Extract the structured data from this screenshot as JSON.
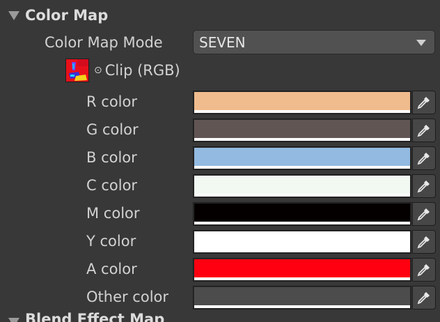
{
  "color_map": {
    "section_title": "Color Map",
    "mode_label": "Color Map Mode",
    "mode_value": "SEVEN",
    "clip_label": "Clip (RGB)",
    "colors": [
      {
        "label": "R color",
        "hex": "#f0bc8e"
      },
      {
        "label": "G color",
        "hex": "#615554"
      },
      {
        "label": "B color",
        "hex": "#93bae0"
      },
      {
        "label": "C color",
        "hex": "#f2f8f2"
      },
      {
        "label": "M color",
        "hex": "#050000"
      },
      {
        "label": "Y color",
        "hex": "#ffffff"
      },
      {
        "label": "A color",
        "hex": "#ff0010"
      },
      {
        "label": "Other color",
        "hex": "#4c4c4c"
      }
    ]
  },
  "next_section": {
    "title": "Blend Effect Map"
  },
  "icons": {
    "foldout": "triangle-down-icon",
    "dropdown": "chevron-down-icon",
    "picker": "eyedropper-icon",
    "texture": "texture-thumbnail",
    "clip": "radio-bullet-icon"
  },
  "colors_ui": {
    "background": "#383838",
    "field_bg": "#515151",
    "text": "#d2d2d2"
  }
}
